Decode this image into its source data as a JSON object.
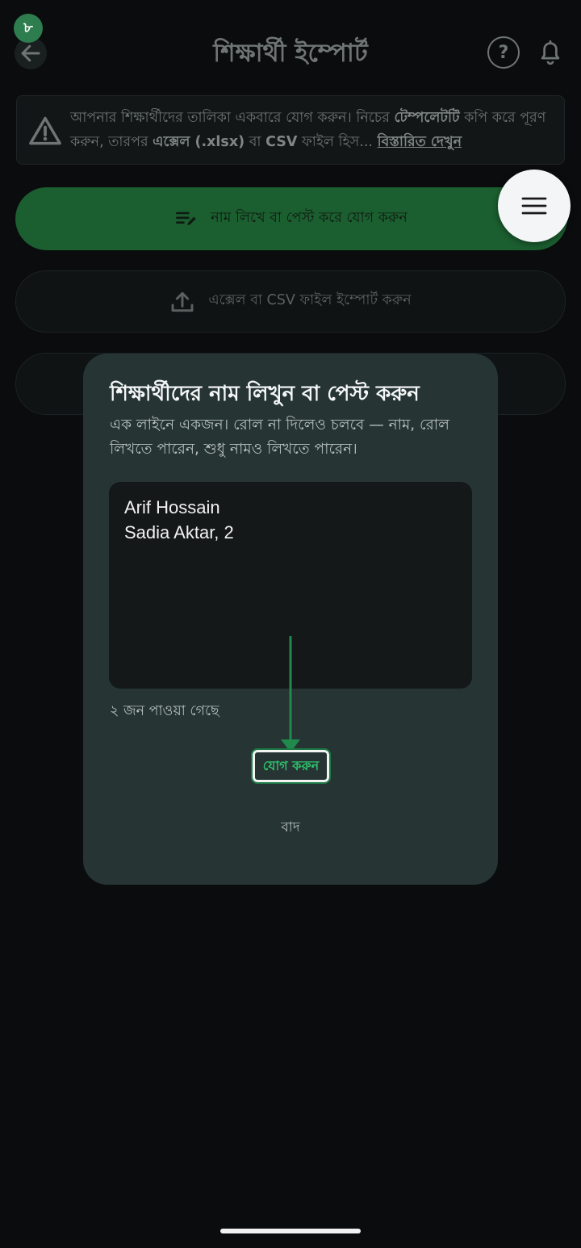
{
  "header": {
    "badge": "৮",
    "title": "শিক্ষার্থী ইম্পোর্ট",
    "help_glyph": "?"
  },
  "banner": {
    "text_part1": "আপনার শিক্ষার্থীদের তালিকা একবারে যোগ করুন। নিচের ",
    "template_word": "টেম্পলেটটি",
    "text_part2": " কপি করে পূরণ করুন, তারপর ",
    "excel_word": "এক্সেল (.xlsx)",
    "text_part3": " বা ",
    "csv_word": "CSV",
    "text_part4": " ফাইল হিস... ",
    "details_link": "বিস্তারিত দেখুন"
  },
  "actions": {
    "paste_label": "নাম লিখে বা পেস্ট করে যোগ করুন",
    "file_label": "এক্সেল বা CSV ফাইল ইম্পোর্ট করুন"
  },
  "dialog": {
    "title": "শিক্ষার্থীদের নাম লিখুন বা পেস্ট করুন",
    "subtitle": "এক লাইনে একজন। রোল না দিলেও চলবে — নাম, রোল লিখতে পারেন, শুধু নামও লিখতে পারেন।",
    "input_value": "Arif Hossain\nSadia Aktar, 2",
    "found_count": "২ জন পাওয়া গেছে",
    "add_label": "যোগ করুন",
    "cancel_label": "বাদ"
  },
  "colors": {
    "accent_green": "#1b5e2f",
    "dialog_bg": "#263434",
    "badge_green": "#2e7d4f",
    "add_text": "#2ec06b"
  },
  "icons": [
    "back-arrow-icon",
    "help-icon",
    "bell-icon",
    "warning-icon",
    "edit-list-icon",
    "upload-icon",
    "menu-icon"
  ]
}
